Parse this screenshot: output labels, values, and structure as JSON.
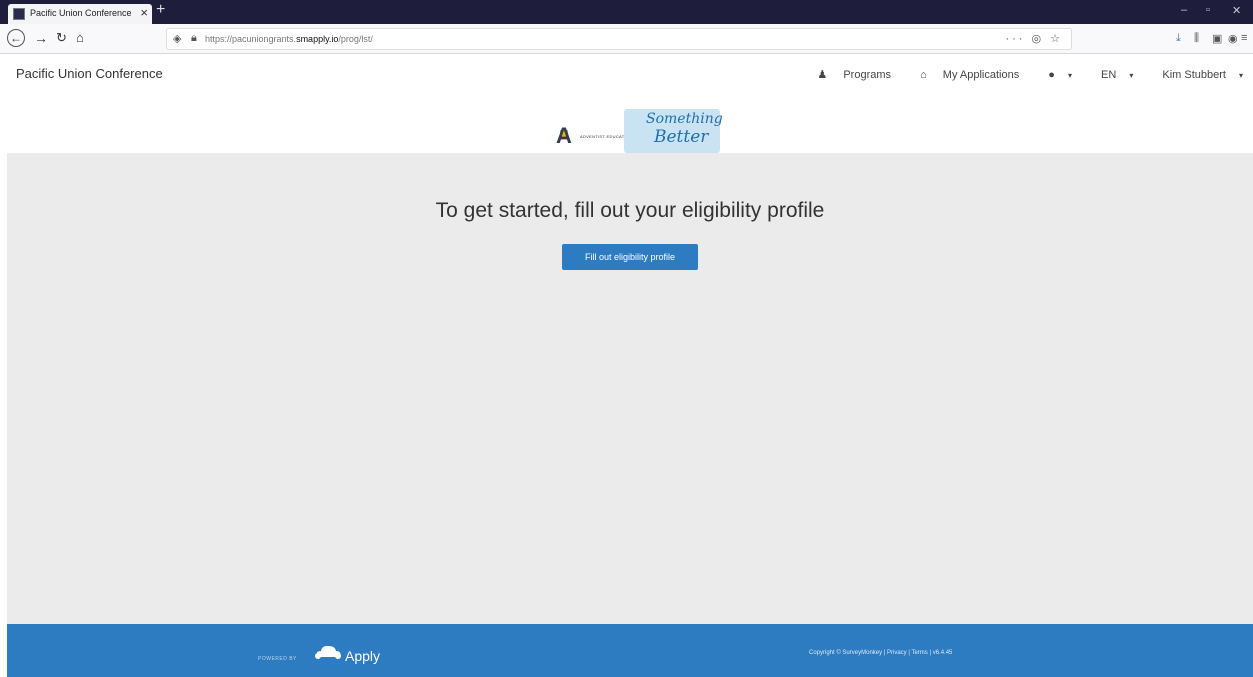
{
  "browser": {
    "tab_title": "Pacific Union Conference",
    "url_prefix": "https://pacuniongrants.",
    "url_domain": "smapply.io",
    "url_path": "/prog/lst/"
  },
  "site": {
    "brand": "Pacific Union Conference",
    "nav": {
      "programs": "Programs",
      "my_applications": "My Applications",
      "language": "EN",
      "user": "Kim Stubbert"
    }
  },
  "logo": {
    "org_text": "ADVENTIST EDUCATION",
    "tagline_line1": "Something",
    "tagline_line2": "Better"
  },
  "main": {
    "heading": "To get started, fill out your eligibility profile",
    "button_label": "Fill out eligibility profile"
  },
  "footer": {
    "powered_by": "POWERED BY",
    "apply_label": "Apply",
    "copyright": "Copyright © SurveyMonkey | Privacy | Terms | v6.4.45"
  },
  "colors": {
    "primary": "#2d7bc0",
    "page_bg": "#ebebeb",
    "browser_chrome": "#1e1e3c"
  }
}
